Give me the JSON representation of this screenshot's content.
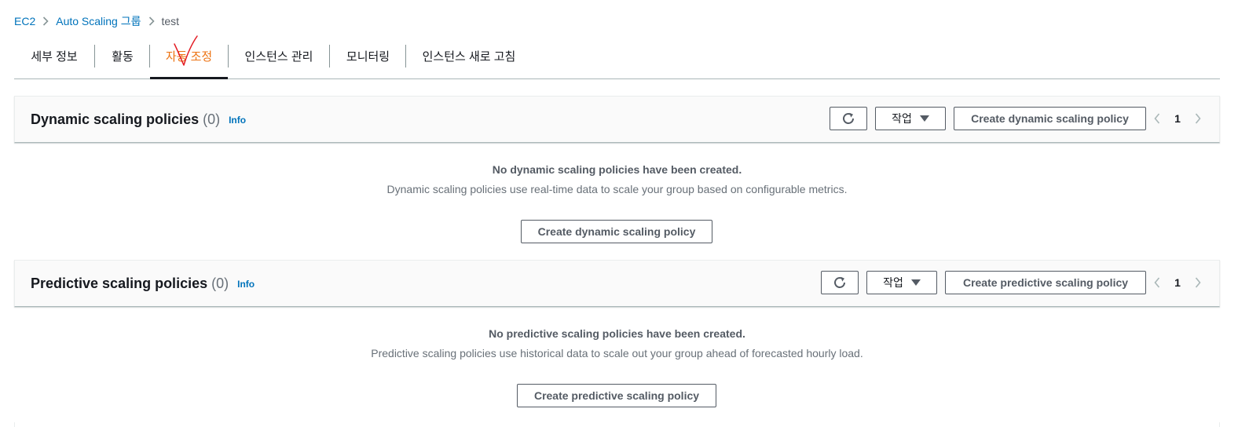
{
  "breadcrumb": {
    "items": [
      "EC2",
      "Auto Scaling 그룹"
    ],
    "current": "test"
  },
  "tabs": [
    {
      "label": "세부 정보",
      "active": false
    },
    {
      "label": "활동",
      "active": false
    },
    {
      "label": "자동 조정",
      "active": true
    },
    {
      "label": "인스턴스 관리",
      "active": false
    },
    {
      "label": "모니터링",
      "active": false
    },
    {
      "label": "인스턴스 새로 고침",
      "active": false
    }
  ],
  "dynamic": {
    "title": "Dynamic scaling policies",
    "count": "(0)",
    "info": "Info",
    "actions_label": "작업",
    "create_label": "Create dynamic scaling policy",
    "page": "1",
    "empty_title": "No dynamic scaling policies have been created.",
    "empty_desc": "Dynamic scaling policies use real-time data to scale your group based on configurable metrics.",
    "empty_button": "Create dynamic scaling policy"
  },
  "predictive": {
    "title": "Predictive scaling policies",
    "count": "(0)",
    "info": "Info",
    "actions_label": "작업",
    "create_label": "Create predictive scaling policy",
    "page": "1",
    "empty_title": "No predictive scaling policies have been created.",
    "empty_desc": "Predictive scaling policies use historical data to scale out your group ahead of forecasted hourly load.",
    "empty_button": "Create predictive scaling policy"
  },
  "icons": {
    "breadcrumb_separator": "chevron-right-icon",
    "refresh": "refresh-icon",
    "dropdown": "caret-down-icon",
    "prev_page": "chevron-left-icon",
    "next_page": "chevron-right-icon",
    "annotation": "checkmark-annotation-icon"
  },
  "colors": {
    "link": "#0073bb",
    "active_tab": "#ec7211",
    "annotation": "#e31b23",
    "text_secondary": "#545b64"
  }
}
